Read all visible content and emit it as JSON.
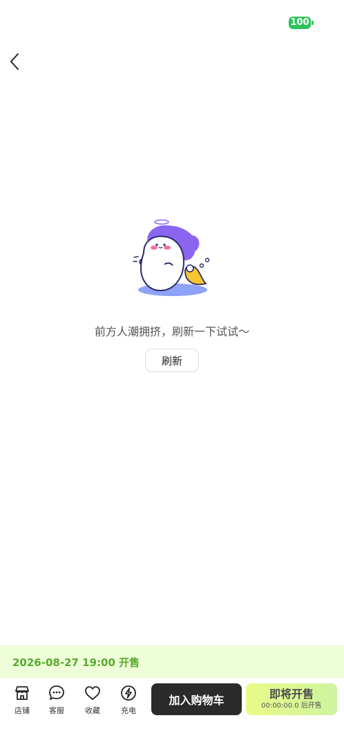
{
  "status_bar": {
    "battery": "100"
  },
  "empty_state": {
    "message": "前方人潮拥挤，刷新一下试试～",
    "refresh_label": "刷新"
  },
  "sale_banner": {
    "text": "2026-08-27 19:00 开售"
  },
  "bottom_bar": {
    "nav": [
      {
        "label": "店铺",
        "icon": "store-icon"
      },
      {
        "label": "客服",
        "icon": "chat-icon"
      },
      {
        "label": "收藏",
        "icon": "heart-icon"
      },
      {
        "label": "充电",
        "icon": "lightning-icon"
      }
    ],
    "cart_label": "加入购物车",
    "presale_title": "即将开售",
    "presale_countdown": "00:00:00.0 后开售"
  },
  "colors": {
    "accent_green": "#58a92e",
    "banner_bg": "#eefed8",
    "battery_green": "#2fc35b"
  }
}
